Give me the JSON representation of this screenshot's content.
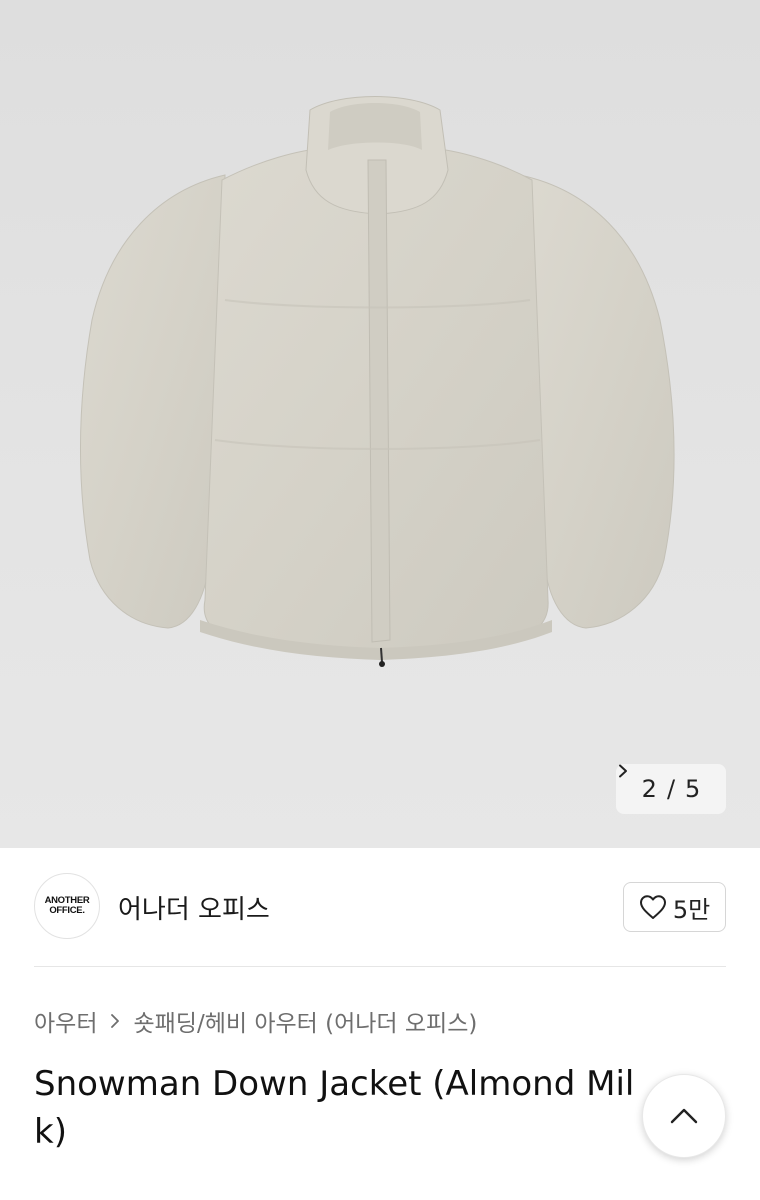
{
  "image_pager": {
    "current": "2",
    "separator": "/",
    "total": "5",
    "next_icon": "chevron-right-icon"
  },
  "store": {
    "logo_text_line1": "ANOTHER",
    "logo_text_line2": "OFFICE.",
    "name": "어나더 오피스",
    "like_icon": "heart-outline-icon",
    "like_count": "5만"
  },
  "breadcrumb": {
    "items": [
      "아우터",
      "숏패딩/헤비 아우터 (어나더 오피스)"
    ],
    "separator_icon": "chevron-right-icon"
  },
  "product": {
    "title": "Snowman Down Jacket (Almond Milk)"
  },
  "scroll_top": {
    "icon": "chevron-up-icon"
  },
  "colors": {
    "hero_background": "#e2e2e2",
    "jacket": "#d8d5cc",
    "text_primary": "#111111",
    "text_secondary": "#6e6e6e"
  }
}
